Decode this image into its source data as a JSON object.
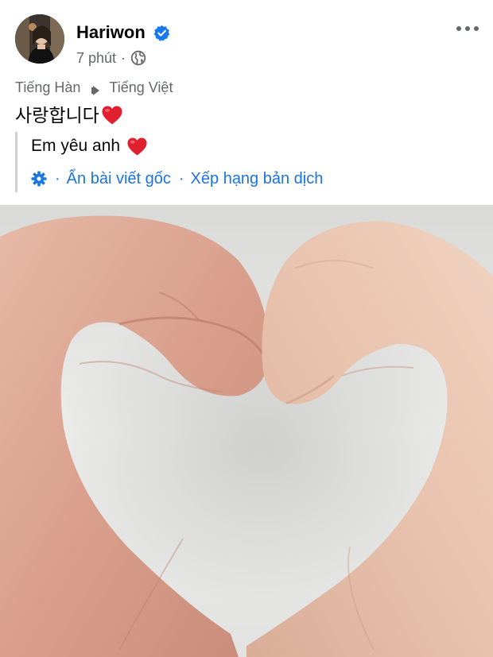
{
  "post": {
    "author": "Hariwon",
    "time": "7 phút",
    "meta_separator": "·",
    "visibility_icon": "globe-icon",
    "verified_icon": "verified-badge-icon",
    "more_icon": "more-options-icon"
  },
  "translation": {
    "source_language": "Tiếng Hàn",
    "target_language": "Tiếng Việt",
    "original_text": "사랑합니다",
    "translated_text": "Em yêu anh",
    "settings_icon": "gear-icon",
    "separator": "·",
    "hide_original_label": "Ẩn bài viết gốc",
    "rate_translation_label": "Xếp hạng bản dịch"
  },
  "colors": {
    "link_blue": "#1b74e4",
    "secondary_text": "#65676b",
    "heart_red": "#e0202f",
    "verified_blue": "#1877f2"
  }
}
